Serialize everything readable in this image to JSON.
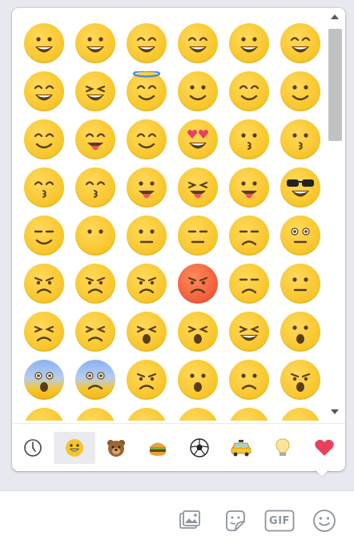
{
  "picker": {
    "categories": [
      {
        "name": "recent",
        "icon": "clock-icon"
      },
      {
        "name": "people",
        "icon": "smiley-icon"
      },
      {
        "name": "nature",
        "icon": "bear-icon"
      },
      {
        "name": "food",
        "icon": "burger-icon"
      },
      {
        "name": "activity",
        "icon": "soccer-ball-icon"
      },
      {
        "name": "travel",
        "icon": "taxi-icon"
      },
      {
        "name": "objects",
        "icon": "lightbulb-icon"
      },
      {
        "name": "symbols",
        "icon": "heart-icon"
      }
    ],
    "active_category": "people",
    "emoji_rows": [
      [
        "😀",
        "😬",
        "😁",
        "😂",
        "😃",
        "😄"
      ],
      [
        "😅",
        "😆",
        "😇",
        "😉",
        "😊",
        "🙂"
      ],
      [
        "☺️",
        "😋",
        "😌",
        "😍",
        "😘",
        "😗"
      ],
      [
        "😙",
        "😚",
        "😜",
        "😝",
        "😛",
        "😎"
      ],
      [
        "😏",
        "😶",
        "😐",
        "😑",
        "😒",
        "😳"
      ],
      [
        "😞",
        "😟",
        "😠",
        "😡",
        "😔",
        "😕"
      ],
      [
        "😣",
        "😖",
        "😫",
        "😩",
        "😤",
        "😮"
      ],
      [
        "😱",
        "😨",
        "😰",
        "😯",
        "😦",
        "😧"
      ],
      [
        "😢",
        "😥",
        "😪",
        "😓",
        "😭",
        "😵"
      ]
    ]
  },
  "composer": {
    "icons": [
      "photo-icon",
      "sticker-icon",
      "gif-icon",
      "emoji-icon"
    ],
    "gif_label": "GIF"
  }
}
